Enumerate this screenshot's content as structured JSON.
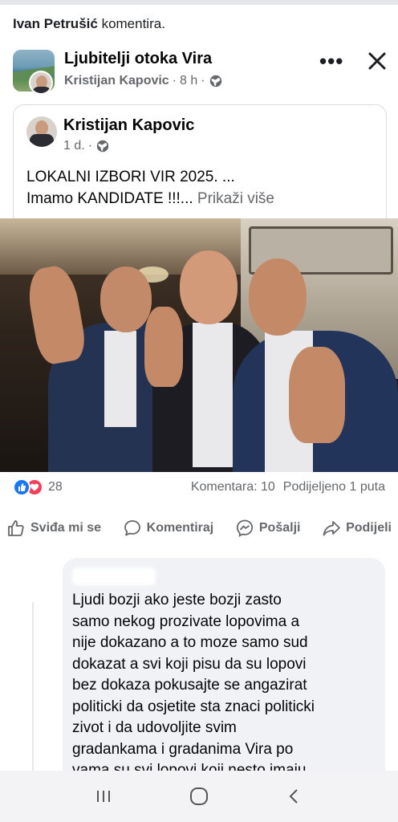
{
  "activity": {
    "user": "Ivan Petrušić",
    "action": "komentira."
  },
  "post": {
    "group_name": "Ljubitelji otoka Vira",
    "author": "Kristijan Kapovic",
    "time": "8 h",
    "separator": "·"
  },
  "shared": {
    "author": "Kristijan Kapovic",
    "time": "1 d.",
    "line1": "LOKALNI IZBORI VIR 2025. ...",
    "line2": "Imamo KANDIDATE !!!...",
    "see_more": "Prikaži više"
  },
  "engagement": {
    "reaction_count": "28",
    "comments": "Komentara: 10",
    "shares": "Podijeljeno 1 puta"
  },
  "actions": {
    "like": "Sviđa mi se",
    "comment": "Komentiraj",
    "send": "Pošalji",
    "share": "Podijeli"
  },
  "comment": {
    "lines": [
      "Ljudi bozji ako jeste bozji zasto",
      "samo nekog prozivate lopovima a",
      "nije dokazano a to moze samo sud",
      "dokazat a svi koji pisu  da su lopovi",
      "bez dokaza pokusajte se angazirat",
      "politicki da osjetite sta znaci politicki",
      "zivot i da udovoljite svim",
      "gradankama i gradanima Vira po",
      "vama su svi lopovi koji nesto imaju"
    ]
  },
  "icons": {
    "globe": "globe-icon",
    "more": "more-icon",
    "close": "close-icon",
    "like": "thumbs-up-icon",
    "comment": "speech-bubble-icon",
    "send": "messenger-icon",
    "share": "share-arrow-icon"
  },
  "colors": {
    "like_blue": "#1877f2",
    "love_red": "#f33e58",
    "meta_gray": "#65676b"
  }
}
